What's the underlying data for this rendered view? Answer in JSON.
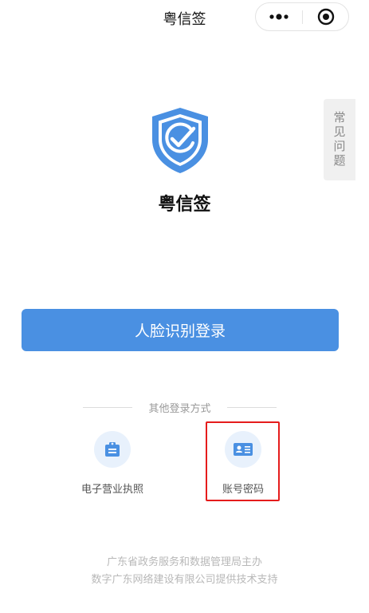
{
  "navbar": {
    "title": "粤信签",
    "more_icon": "more-dots-icon",
    "close_icon": "target-close-icon"
  },
  "faq": {
    "label": "常见问题"
  },
  "brand": {
    "logo_icon": "shield-check-icon",
    "app_name": "粤信签",
    "primary_color": "#4a90e2"
  },
  "login": {
    "face_button_label": "人脸识别登录"
  },
  "other_login": {
    "divider_text": "其他登录方式",
    "methods": [
      {
        "label": "电子营业执照",
        "icon": "license-card-icon"
      },
      {
        "label": "账号密码",
        "icon": "id-card-icon"
      }
    ]
  },
  "footer": {
    "line1": "广东省政务服务和数据管理局主办",
    "line2": "数字广东网络建设有限公司提供技术支持"
  },
  "highlight_color": "#e51c1c"
}
